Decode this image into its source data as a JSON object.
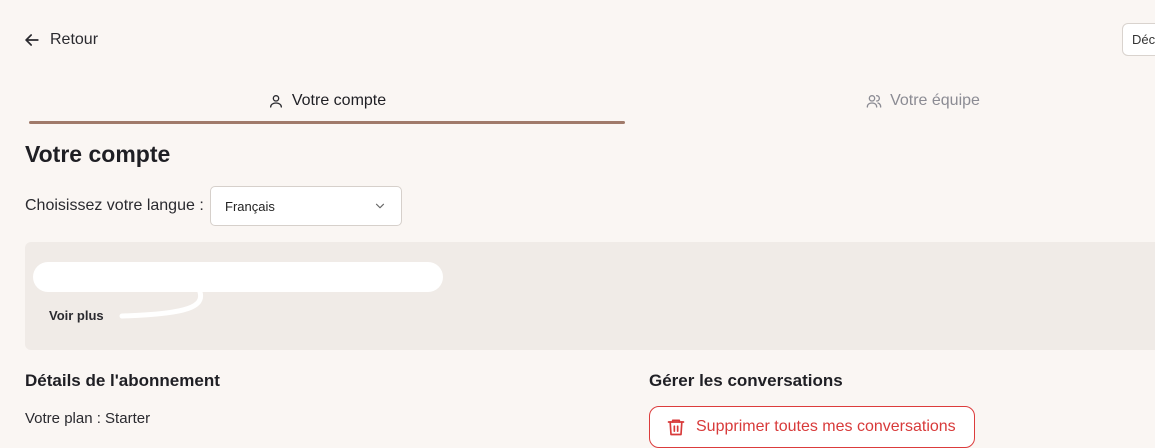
{
  "header": {
    "back_label": "Retour",
    "top_right_button_label": "Déc"
  },
  "tabs": [
    {
      "label": "Votre compte",
      "icon": "user-icon",
      "active": true
    },
    {
      "label": "Votre équipe",
      "icon": "users-icon",
      "active": false
    }
  ],
  "account": {
    "title": "Votre compte",
    "language_label": "Choisissez votre langue :",
    "language_value": "Français"
  },
  "info_panel": {
    "more_label": "Voir plus"
  },
  "subscription": {
    "title": "Détails de l'abonnement",
    "plan_text": "Votre plan : Starter"
  },
  "conversations": {
    "title": "Gérer les conversations",
    "delete_label": "Supprimer toutes mes conversations"
  },
  "colors": {
    "accent": "#a07a6a",
    "danger": "#d83a3a",
    "background": "#faf6f3",
    "panel": "#f0ebe7"
  }
}
